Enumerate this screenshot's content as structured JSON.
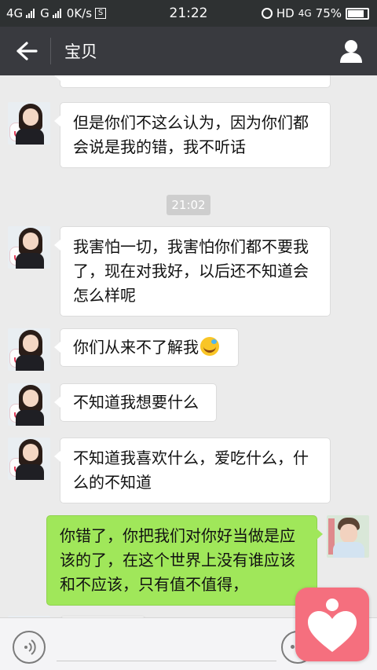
{
  "status_bar": {
    "network1": "4G",
    "network2": "G",
    "speed": "0K/s",
    "s_badge": "S",
    "time": "21:22",
    "hd": "HD",
    "network3": "4G",
    "battery": "75%"
  },
  "header": {
    "title": "宝贝"
  },
  "chat": {
    "timestamp": "21:02",
    "messages": [
      {
        "side": "left",
        "lines": [
          "但是你们不这么认为，因为你们都",
          "会说是我的错，我不听话"
        ]
      },
      {
        "side": "left",
        "lines": [
          "我害怕一切，我害怕你们都不要我",
          "了，现在对我好，以后还不知道会",
          "怎么样呢"
        ]
      },
      {
        "side": "left",
        "lines": [
          "你们从来不了解我"
        ],
        "emoji": "crying-laughing-emoji"
      },
      {
        "side": "left",
        "lines": [
          "不知道我想要什么"
        ]
      },
      {
        "side": "left",
        "lines": [
          "不知道我喜欢什么，爱吃什么，什",
          "么的不知道"
        ]
      },
      {
        "side": "right",
        "lines": [
          "你错了，你把我们对你好当做是应",
          "该的了，在这个世界上没有谁应该",
          "和不应该，只有值不值得，"
        ]
      }
    ]
  },
  "colors": {
    "status_bg": "#2e3132",
    "title_bg": "#393a3f",
    "chat_bg": "#ebebeb",
    "sent_bubble": "#a0e75a",
    "received_bubble": "#ffffff",
    "float_app": "#f56f7e"
  },
  "icons": {
    "back": "back-arrow-icon",
    "profile": "user-profile-icon",
    "voice": "voice-icon",
    "emoji": "emoji-icon",
    "float": "heart-app-icon"
  }
}
